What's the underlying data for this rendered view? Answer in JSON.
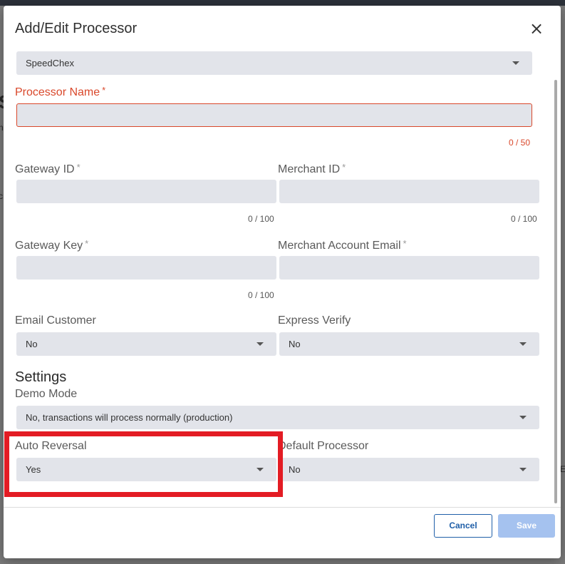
{
  "background": {
    "fragment_heading": "S",
    "fragment_text_1": "n",
    "fragment_text_2": "c",
    "fragment_text_3": "E"
  },
  "modal": {
    "title": "Add/Edit Processor",
    "close_icon": "close-icon"
  },
  "processor_type": {
    "value": "SpeedChex"
  },
  "processor_name": {
    "label": "Processor Name",
    "required": "*",
    "value": "",
    "counter": "0 / 50"
  },
  "gateway_id": {
    "label": "Gateway ID",
    "required": "*",
    "value": "",
    "counter": "0 / 100"
  },
  "merchant_id": {
    "label": "Merchant ID",
    "required": "*",
    "value": "",
    "counter": "0 / 100"
  },
  "gateway_key": {
    "label": "Gateway Key",
    "required": "*",
    "value": "",
    "counter": "0 / 100"
  },
  "merchant_account_email": {
    "label": "Merchant Account Email",
    "required": "*",
    "value": ""
  },
  "email_customer": {
    "label": "Email Customer",
    "value": "No"
  },
  "express_verify": {
    "label": "Express Verify",
    "value": "No"
  },
  "settings": {
    "heading": "Settings",
    "demo_mode": {
      "label": "Demo Mode",
      "value": "No, transactions will process normally (production)"
    },
    "auto_reversal": {
      "label": "Auto Reversal",
      "value": "Yes"
    },
    "default_processor": {
      "label": "Default Processor",
      "value": "No"
    }
  },
  "footer": {
    "cancel_label": "Cancel",
    "save_label": "Save"
  },
  "colors": {
    "error": "#d9482b",
    "field_bg": "#e2e4ea",
    "primary": "#1f5fa8",
    "save_disabled": "#a5c2ef",
    "highlight": "#e31c24"
  }
}
